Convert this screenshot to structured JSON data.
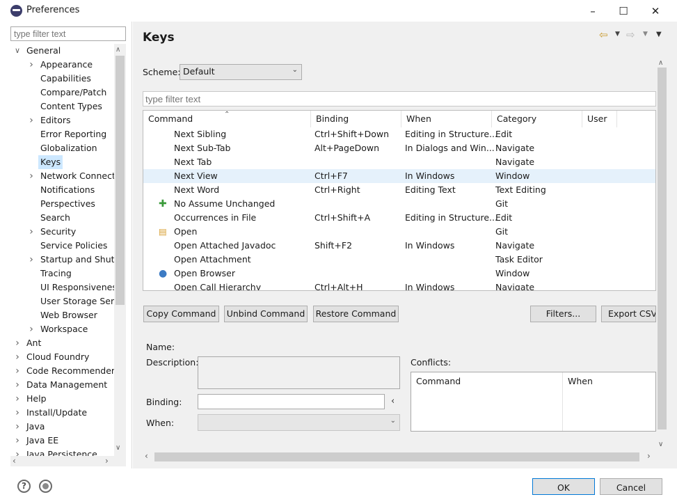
{
  "window": {
    "title": "Preferences",
    "minimize": "–",
    "maximize": "☐",
    "close": "✕"
  },
  "left": {
    "filter_placeholder": "type filter text",
    "tree": [
      {
        "label": "General",
        "level": 0,
        "twisty": "open"
      },
      {
        "label": "Appearance",
        "level": 1,
        "twisty": "closed"
      },
      {
        "label": "Capabilities",
        "level": 1,
        "twisty": ""
      },
      {
        "label": "Compare/Patch",
        "level": 1,
        "twisty": ""
      },
      {
        "label": "Content Types",
        "level": 1,
        "twisty": ""
      },
      {
        "label": "Editors",
        "level": 1,
        "twisty": "closed"
      },
      {
        "label": "Error Reporting",
        "level": 1,
        "twisty": ""
      },
      {
        "label": "Globalization",
        "level": 1,
        "twisty": ""
      },
      {
        "label": "Keys",
        "level": 1,
        "twisty": "",
        "selected": true
      },
      {
        "label": "Network Connecti",
        "level": 1,
        "twisty": "closed"
      },
      {
        "label": "Notifications",
        "level": 1,
        "twisty": ""
      },
      {
        "label": "Perspectives",
        "level": 1,
        "twisty": ""
      },
      {
        "label": "Search",
        "level": 1,
        "twisty": ""
      },
      {
        "label": "Security",
        "level": 1,
        "twisty": "closed"
      },
      {
        "label": "Service Policies",
        "level": 1,
        "twisty": ""
      },
      {
        "label": "Startup and Shutd",
        "level": 1,
        "twisty": "closed"
      },
      {
        "label": "Tracing",
        "level": 1,
        "twisty": ""
      },
      {
        "label": "UI Responsivenes",
        "level": 1,
        "twisty": ""
      },
      {
        "label": "User Storage Serv",
        "level": 1,
        "twisty": ""
      },
      {
        "label": "Web Browser",
        "level": 1,
        "twisty": ""
      },
      {
        "label": "Workspace",
        "level": 1,
        "twisty": "closed"
      },
      {
        "label": "Ant",
        "level": 0,
        "twisty": "closed"
      },
      {
        "label": "Cloud Foundry",
        "level": 0,
        "twisty": "closed"
      },
      {
        "label": "Code Recommenders",
        "level": 0,
        "twisty": "closed"
      },
      {
        "label": "Data Management",
        "level": 0,
        "twisty": "closed"
      },
      {
        "label": "Help",
        "level": 0,
        "twisty": "closed"
      },
      {
        "label": "Install/Update",
        "level": 0,
        "twisty": "closed"
      },
      {
        "label": "Java",
        "level": 0,
        "twisty": "closed"
      },
      {
        "label": "Java EE",
        "level": 0,
        "twisty": "closed"
      },
      {
        "label": "Java Persistence",
        "level": 0,
        "twisty": "closed"
      }
    ]
  },
  "page": {
    "title": "Keys",
    "scheme_label": "Scheme:",
    "scheme_value": "Default",
    "filter_placeholder": "type filter text",
    "columns": [
      "Command",
      "Binding",
      "When",
      "Category",
      "User"
    ],
    "rows": [
      {
        "command": "Next Sibling",
        "binding": "Ctrl+Shift+Down",
        "when": "Editing in Structure...",
        "category": "Edit",
        "icon": ""
      },
      {
        "command": "Next Sub-Tab",
        "binding": "Alt+PageDown",
        "when": "In Dialogs and Win...",
        "category": "Navigate",
        "icon": ""
      },
      {
        "command": "Next Tab",
        "binding": "",
        "when": "",
        "category": "Navigate",
        "icon": ""
      },
      {
        "command": "Next View",
        "binding": "Ctrl+F7",
        "when": "In Windows",
        "category": "Window",
        "icon": "",
        "selected": true
      },
      {
        "command": "Next Word",
        "binding": "Ctrl+Right",
        "when": "Editing Text",
        "category": "Text Editing",
        "icon": ""
      },
      {
        "command": "No Assume Unchanged",
        "binding": "",
        "when": "",
        "category": "Git",
        "icon": "git-plus-icon"
      },
      {
        "command": "Occurrences in File",
        "binding": "Ctrl+Shift+A",
        "when": "Editing in Structure...",
        "category": "Edit",
        "icon": ""
      },
      {
        "command": "Open",
        "binding": "",
        "when": "",
        "category": "Git",
        "icon": "folder-icon"
      },
      {
        "command": "Open Attached Javadoc",
        "binding": "Shift+F2",
        "when": "In Windows",
        "category": "Navigate",
        "icon": ""
      },
      {
        "command": "Open Attachment",
        "binding": "",
        "when": "",
        "category": "Task Editor",
        "icon": ""
      },
      {
        "command": "Open Browser",
        "binding": "",
        "when": "",
        "category": "Window",
        "icon": "globe-icon"
      },
      {
        "command": "Open Call Hierarchy",
        "binding": "Ctrl+Alt+H",
        "when": "In Windows",
        "category": "Navigate",
        "icon": ""
      }
    ],
    "buttons": {
      "copy": "Copy Command",
      "unbind": "Unbind Command",
      "restore": "Restore Command",
      "filters": "Filters...",
      "export": "Export CSV..."
    },
    "details": {
      "name_label": "Name:",
      "description_label": "Description:",
      "binding_label": "Binding:",
      "when_label": "When:",
      "conflicts_label": "Conflicts:",
      "conflicts_columns": [
        "Command",
        "When"
      ]
    }
  },
  "bottom": {
    "ok": "OK",
    "cancel": "Cancel",
    "help_glyph": "?"
  }
}
